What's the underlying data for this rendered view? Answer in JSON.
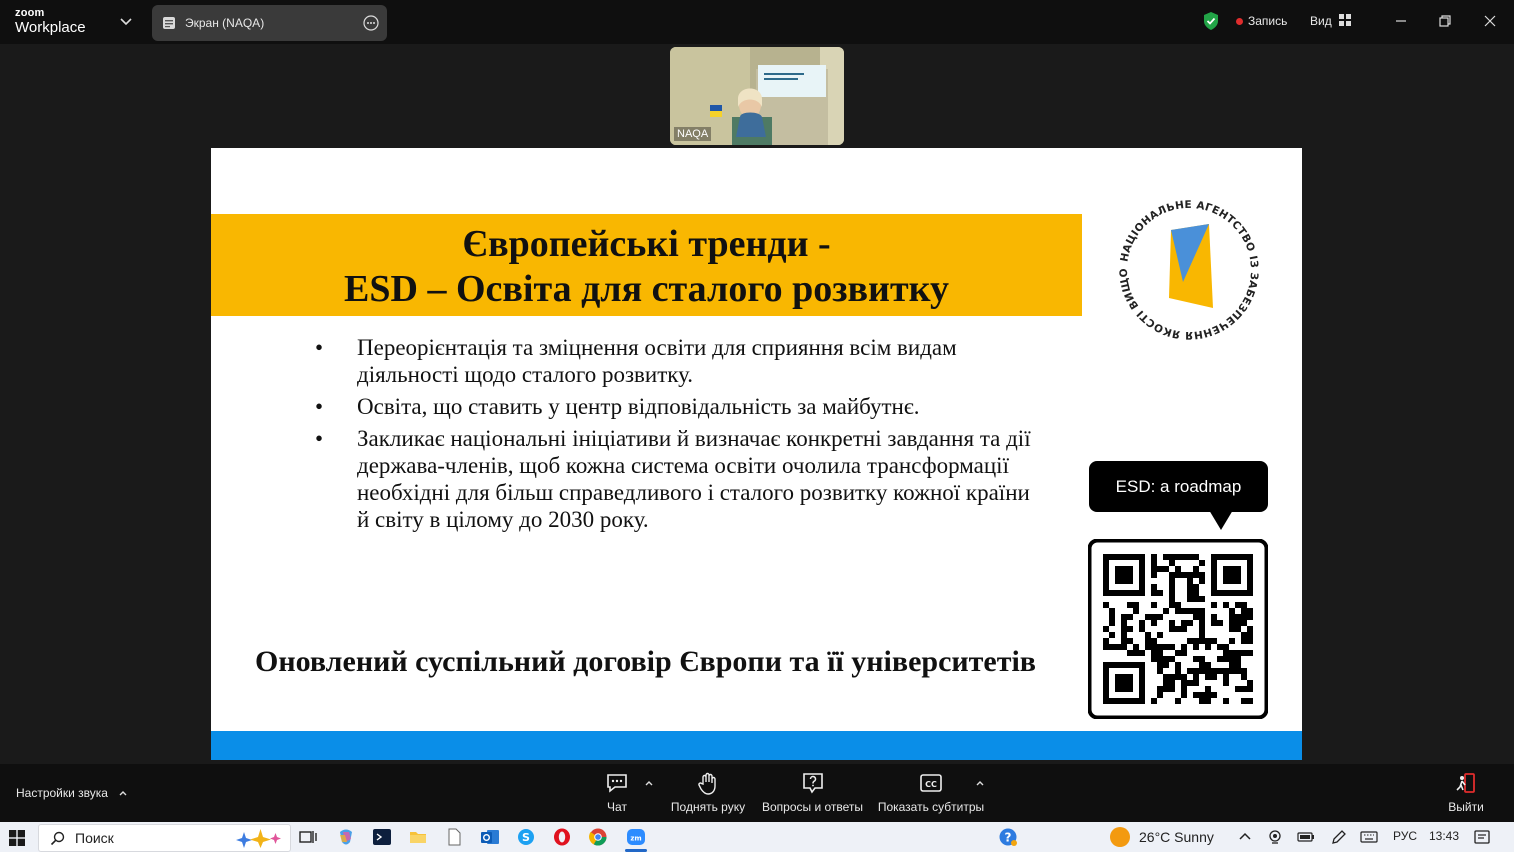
{
  "app": {
    "brand_small": "zoom",
    "brand_big": "Workplace",
    "share_tab_label": "Экран (NAQA)",
    "record_label": "Запись",
    "view_label": "Вид",
    "accent_colors": {
      "record": "#e02d2d",
      "shield": "#22a447"
    }
  },
  "video": {
    "participant_name": "NAQA"
  },
  "slide": {
    "title_line1": "Європейські тренди -",
    "title_line2": "ESD – Освіта для сталого розвитку",
    "bullets": [
      "Переорієнтація та зміцнення освіти для сприяння всім видам діяльності щодо сталого розвитку.",
      "Освіта, що ставить у центр відповідальність за майбутнє.",
      "Закликає національні ініціативи й визначає конкретні завдання та дії держава-членів, щоб кожна система освіти очолила трансформації необхідні для більш справедливого і сталого розвитку кожної країни й світу в цілому до 2030 року."
    ],
    "bullet_marker": "•",
    "conclusion": "Оновлений суспільний договір Європи та її університетів",
    "seal_text": "НАЦІОНАЛЬНЕ АГЕНТСТВО ІЗ ЗАБЕЗПЕЧЕННЯ ЯКОСТІ ВИЩОЇ ОСВІТИ",
    "roadmap_label": "ESD: a roadmap",
    "colors": {
      "banner": "#f9b701",
      "footer": "#0a8ee8"
    }
  },
  "toolbar": {
    "audio_settings": "Настройки звука",
    "chat": "Чат",
    "raise_hand": "Поднять руку",
    "qa": "Вопросы и ответы",
    "captions": "Показать субтитры",
    "leave": "Выйти"
  },
  "taskbar": {
    "search_label": "Поиск",
    "weather": "26°C  Sunny",
    "language": "РУС",
    "time": "13:43"
  }
}
